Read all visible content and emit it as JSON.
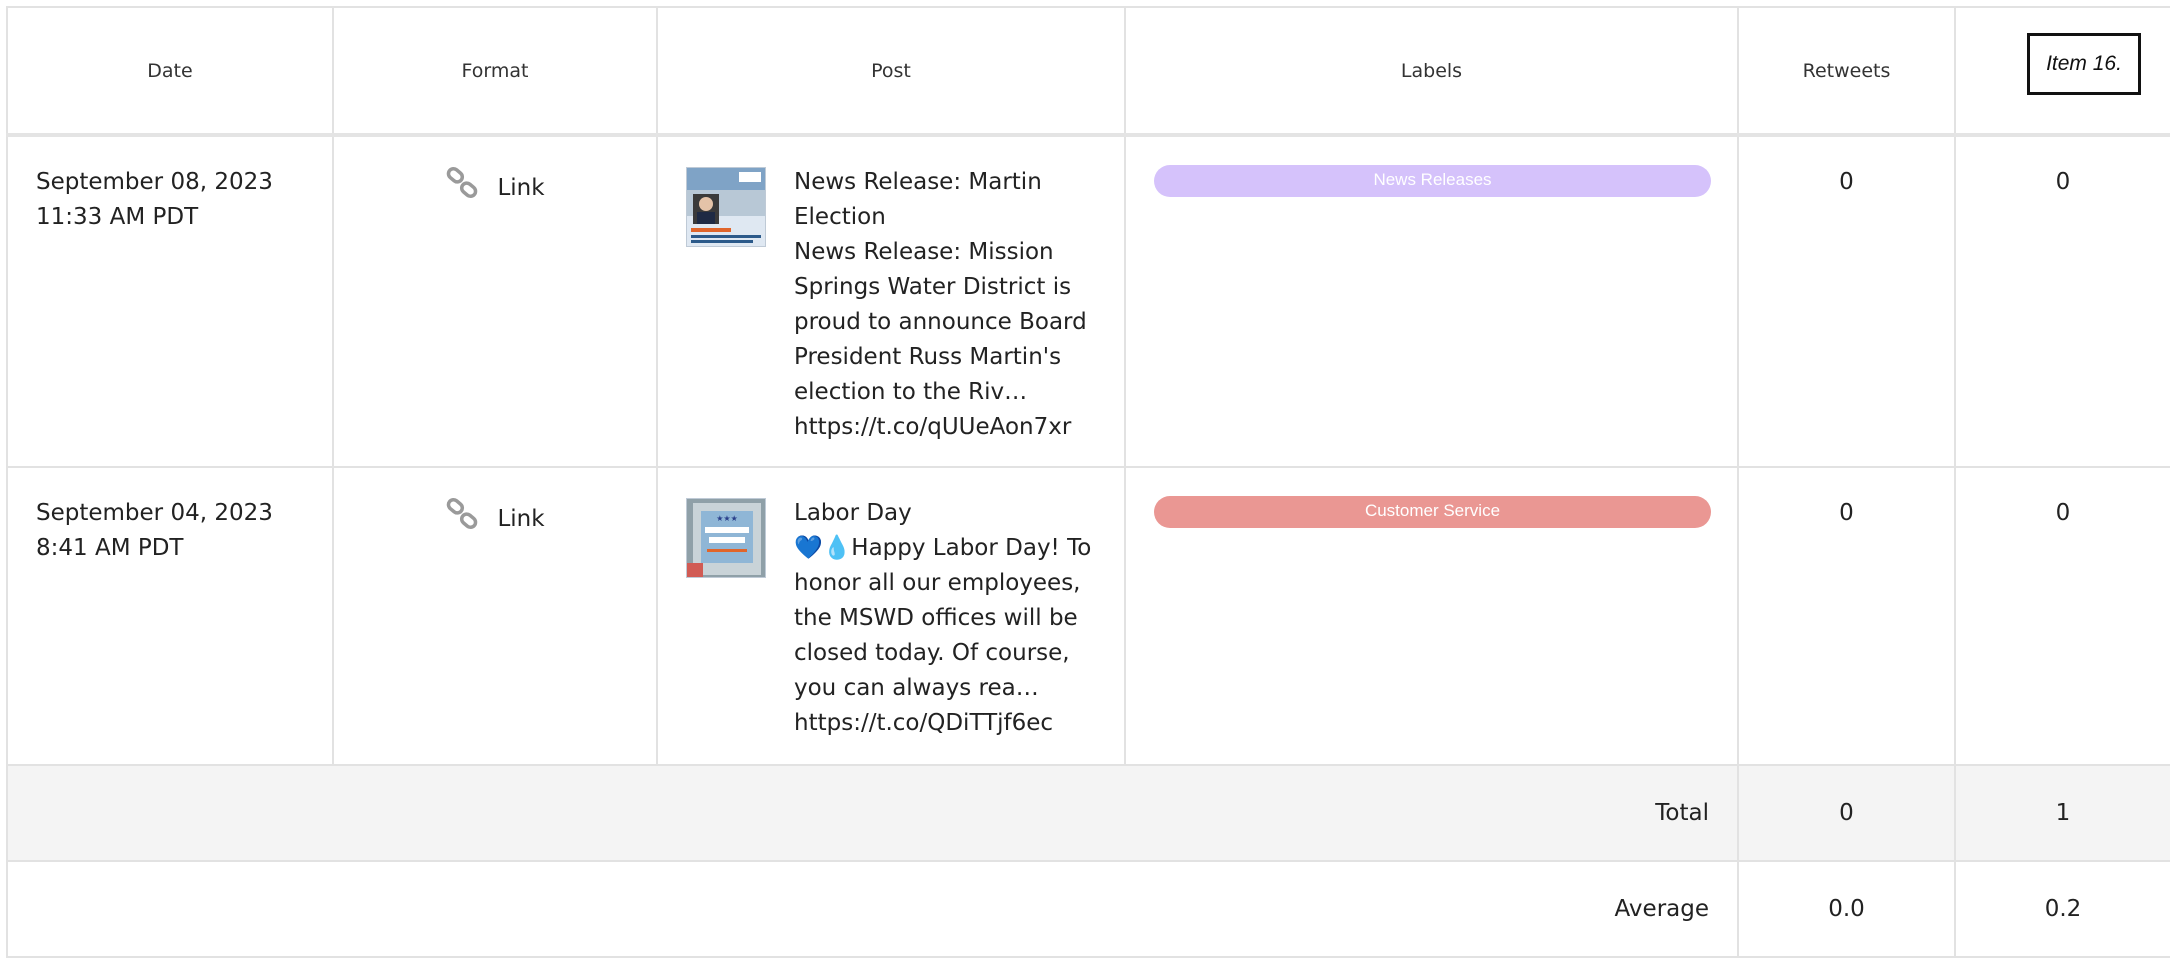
{
  "table": {
    "headers": {
      "date": "Date",
      "format": "Format",
      "post": "Post",
      "labels": "Labels",
      "retweets": "Retweets"
    },
    "item_tag": "Item 16.",
    "rows": [
      {
        "date": "September 08, 2023",
        "time": "11:33 AM PDT",
        "format": "Link",
        "post_title": "News Release: Martin Election",
        "post_body": "News Release: Mission Springs Water District is proud to announce Board President Russ Martin's election to the Riv… https://t.co/qUUeAon7xr",
        "thumbnail": "news-release-thumbnail",
        "label": "News Releases",
        "label_color": "#d5c2fb",
        "retweets": "0",
        "col6": "0"
      },
      {
        "date": "September 04, 2023",
        "time": "8:41 AM PDT",
        "format": "Link",
        "post_title": "Labor Day",
        "post_body": "💙💧Happy Labor Day! To honor all our employees, the MSWD offices will be closed today. Of course, you can always rea… https://t.co/QDiTTjf6ec",
        "thumbnail": "labor-day-thumbnail",
        "label": "Customer Service",
        "label_color": "#ea9793",
        "retweets": "0",
        "col6": "0"
      }
    ],
    "summary": {
      "total_label": "Total",
      "total_retweets": "0",
      "total_col6": "1",
      "average_label": "Average",
      "average_retweets": "0.0",
      "average_col6": "0.2"
    },
    "icons": {
      "format": "link-icon"
    }
  }
}
